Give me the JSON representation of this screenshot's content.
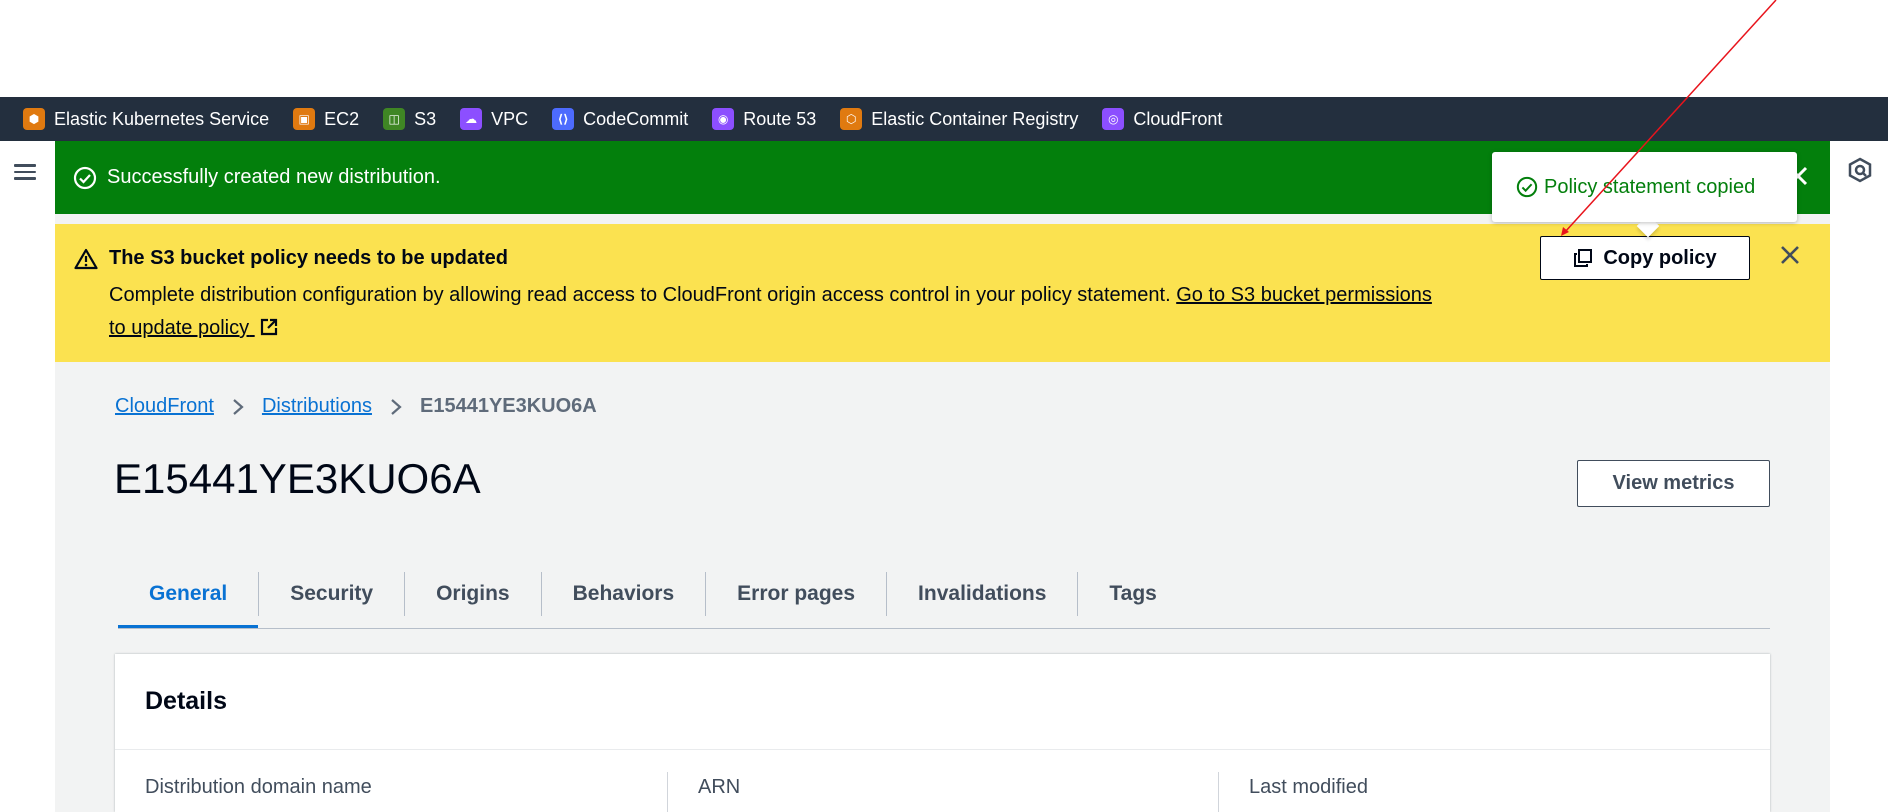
{
  "services": [
    {
      "label": "Elastic Kubernetes Service",
      "color": "#e07a10",
      "icon": "eks-icon"
    },
    {
      "label": "EC2",
      "color": "#e07a10",
      "icon": "ec2-icon"
    },
    {
      "label": "S3",
      "color": "#3f8624",
      "icon": "s3-icon"
    },
    {
      "label": "VPC",
      "color": "#8c4fff",
      "icon": "vpc-icon"
    },
    {
      "label": "CodeCommit",
      "color": "#4d6bfe",
      "icon": "codecommit-icon"
    },
    {
      "label": "Route 53",
      "color": "#8c4fff",
      "icon": "route53-icon"
    },
    {
      "label": "Elastic Container Registry",
      "color": "#e07a10",
      "icon": "ecr-icon"
    },
    {
      "label": "CloudFront",
      "color": "#8c4fff",
      "icon": "cloudfront-icon"
    }
  ],
  "flash_success": {
    "message": "Successfully created new distribution."
  },
  "flash_warning": {
    "title": "The S3 bucket policy needs to be updated",
    "body": "Complete distribution configuration by allowing read access to CloudFront origin access control in your policy statement. ",
    "link": "Go to S3 bucket permissions to update policy",
    "copy_button": "Copy policy"
  },
  "popover": {
    "message": "Policy statement copied"
  },
  "breadcrumb": {
    "root": "CloudFront",
    "parent": "Distributions",
    "current": "E15441YE3KUO6A"
  },
  "page": {
    "title": "E15441YE3KUO6A",
    "metrics_button": "View metrics"
  },
  "tabs": [
    "General",
    "Security",
    "Origins",
    "Behaviors",
    "Error pages",
    "Invalidations",
    "Tags"
  ],
  "details": {
    "title": "Details",
    "columns": [
      "Distribution domain name",
      "ARN",
      "Last modified"
    ]
  },
  "colors": {
    "nav_bg": "#232f3e",
    "success": "#037f0c",
    "warning": "#fbe250",
    "link": "#0972d3"
  }
}
